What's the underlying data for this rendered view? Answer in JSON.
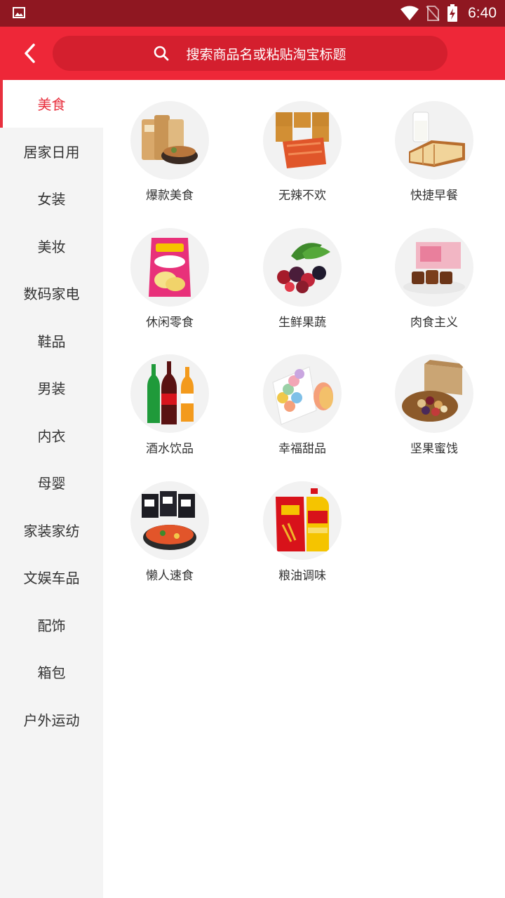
{
  "status_bar": {
    "time": "6:40"
  },
  "header": {
    "search_placeholder": "搜索商品名或粘贴淘宝标题"
  },
  "sidebar": {
    "active_index": 0,
    "items": [
      {
        "label": "美食"
      },
      {
        "label": "居家日用"
      },
      {
        "label": "女装"
      },
      {
        "label": "美妆"
      },
      {
        "label": "数码家电"
      },
      {
        "label": "鞋品"
      },
      {
        "label": "男装"
      },
      {
        "label": "内衣"
      },
      {
        "label": "母婴"
      },
      {
        "label": "家装家纺"
      },
      {
        "label": "文娱车品"
      },
      {
        "label": "配饰"
      },
      {
        "label": "箱包"
      },
      {
        "label": "户外运动"
      }
    ]
  },
  "categories": [
    {
      "label": "爆款美食",
      "icon": "snack-bags-noodle-bowl"
    },
    {
      "label": "无辣不欢",
      "icon": "spicy-strips-packs"
    },
    {
      "label": "快捷早餐",
      "icon": "milk-bread"
    },
    {
      "label": "休闲零食",
      "icon": "potato-chips-bag"
    },
    {
      "label": "生鲜果蔬",
      "icon": "berries"
    },
    {
      "label": "肉食主义",
      "icon": "meat-gift-box"
    },
    {
      "label": "酒水饮品",
      "icon": "soda-bottles"
    },
    {
      "label": "幸福甜品",
      "icon": "macarons-box"
    },
    {
      "label": "坚果蜜饯",
      "icon": "nuts-gift-box"
    },
    {
      "label": "懒人速食",
      "icon": "instant-noodle-packs"
    },
    {
      "label": "粮油调味",
      "icon": "rice-bag-oil-bottle"
    }
  ],
  "colors": {
    "accent": "#ee2738",
    "status_bar": "#8f1721",
    "active_text": "#e8303e"
  }
}
